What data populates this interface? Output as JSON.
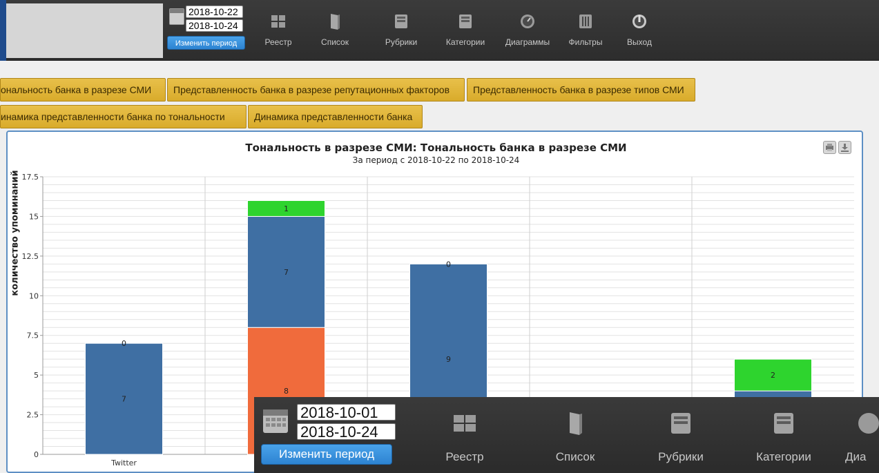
{
  "toolbar": {
    "date_from": "2018-10-22",
    "date_to": "2018-10-24",
    "period_button": "Изменить период",
    "nav": [
      {
        "label": "Реестр",
        "icon": "grid-icon"
      },
      {
        "label": "Список",
        "icon": "book-icon"
      },
      {
        "label": "Рубрики",
        "icon": "inbox-tray-icon"
      },
      {
        "label": "Категории",
        "icon": "inbox-tray-icon"
      },
      {
        "label": "Диаграммы",
        "icon": "gauge-icon"
      },
      {
        "label": "Фильтры",
        "icon": "sliders-icon"
      },
      {
        "label": "Выход",
        "icon": "power-icon"
      }
    ]
  },
  "tabs": [
    "ональность банка в разрезе СМИ",
    "Представленность банка в разрезе репутационных факторов",
    "Представленность банка в разрезе типов СМИ",
    "инамика представленности банка по тональности",
    "Динамика представленности банка"
  ],
  "chart_data": {
    "type": "bar",
    "title": "Тональность в разрезе СМИ: Тональность банка в разрезе СМИ",
    "subtitle": "За период с 2018-10-22 по 2018-10-24",
    "ylabel": "количество упоминаний",
    "ylim": [
      0,
      17.5
    ],
    "yticks": [
      "0",
      "2.5",
      "5",
      "7.5",
      "10",
      "12.5",
      "15",
      "17.5"
    ],
    "categories": [
      "Twitter",
      "",
      "",
      "",
      ""
    ],
    "stacks": [
      [
        {
          "value": 7,
          "label": "7",
          "color": "#3f6fa3"
        },
        {
          "value": 0,
          "label": "0",
          "color": "#3f6fa3"
        }
      ],
      [
        {
          "value": 8,
          "label": "8",
          "color": "#f06b3c"
        },
        {
          "value": 7,
          "label": "7",
          "color": "#3f6fa3"
        },
        {
          "value": 1,
          "label": "1",
          "color": "#2ed42e"
        }
      ],
      [
        {
          "value": 12,
          "label": "9",
          "color": "#3f6fa3"
        },
        {
          "value": 0,
          "label": "0",
          "color": "#3f6fa3"
        }
      ],
      [],
      [
        {
          "value": 4,
          "label": "",
          "color": "#3f6fa3"
        },
        {
          "value": 2,
          "label": "2",
          "color": "#2ed42e"
        }
      ]
    ],
    "grid": true
  },
  "overlay": {
    "date_from": "2018-10-01",
    "date_to": "2018-10-24",
    "period_button": "Изменить период",
    "nav": [
      {
        "label": "Реестр",
        "icon": "grid-icon"
      },
      {
        "label": "Список",
        "icon": "book-icon"
      },
      {
        "label": "Рубрики",
        "icon": "inbox-tray-icon"
      },
      {
        "label": "Категории",
        "icon": "inbox-tray-icon"
      },
      {
        "label": "Диа",
        "icon": "gauge-icon"
      }
    ]
  }
}
